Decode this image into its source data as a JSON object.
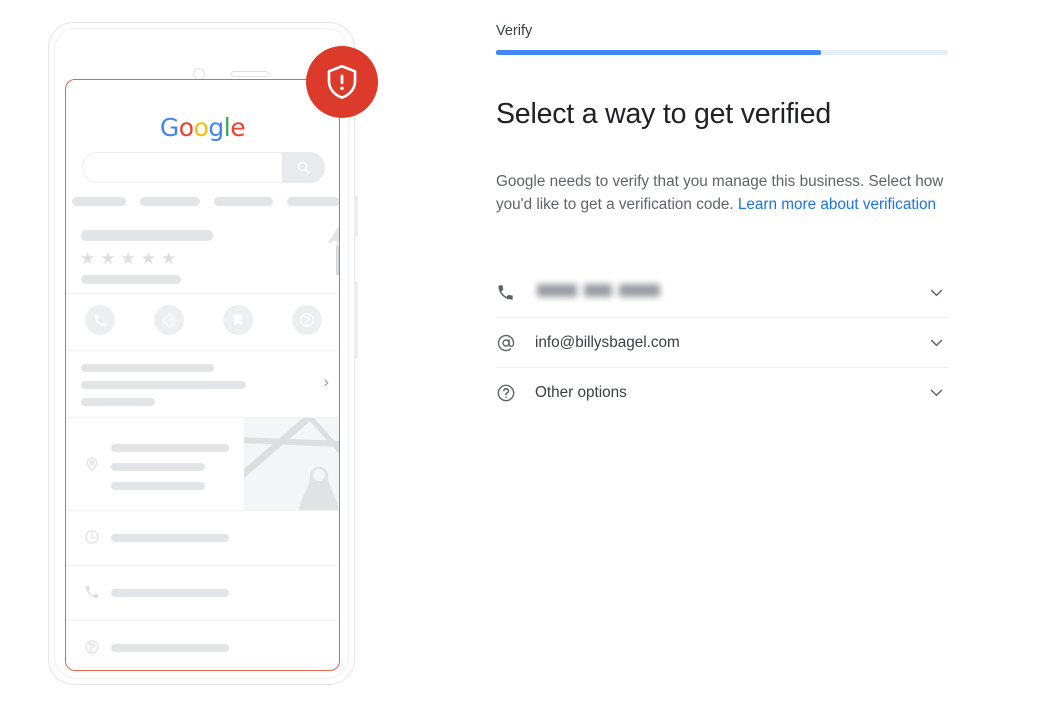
{
  "step": {
    "label": "Verify",
    "progress_percent": 72
  },
  "heading": "Select a way to get verified",
  "body": {
    "sentence1": "Google needs to verify that you manage this business.",
    "sentence2": "Select how you'd like to get a verification code.",
    "link_text": "Learn more about verification"
  },
  "options": [
    {
      "icon": "phone-icon",
      "label": "",
      "redacted": true,
      "chevron": "chevron-down-icon"
    },
    {
      "icon": "at-sign-icon",
      "label": "info@billysbagel.com",
      "redacted": false,
      "chevron": "chevron-down-icon"
    },
    {
      "icon": "help-circle-icon",
      "label": "Other options",
      "redacted": false,
      "chevron": "chevron-down-icon"
    }
  ],
  "illustration": {
    "badge_icon": "shield-exclamation-icon",
    "google_logo": {
      "letters": [
        "G",
        "o",
        "o",
        "g",
        "l",
        "e"
      ],
      "colors": [
        "#4285f4",
        "#ea4335",
        "#fbbc05",
        "#4285f4",
        "#34a853",
        "#ea4335"
      ]
    },
    "search_icon": "search-icon",
    "rating_stars": 5,
    "action_icons": [
      "call-icon",
      "directions-icon",
      "save-icon",
      "website-icon"
    ],
    "detail_icons": [
      "location-pin-icon",
      "clock-icon",
      "phone-icon",
      "globe-icon"
    ],
    "storefront_icon": "storefront-icon",
    "map_pin_icon": "map-pin-icon",
    "chevron_right_icon": "chevron-right-icon"
  },
  "colors": {
    "accent_blue": "#4285f4",
    "link_blue": "#1a73e8",
    "alert_red": "#dc3b2c",
    "screen_outline_red": "#e8654f"
  }
}
